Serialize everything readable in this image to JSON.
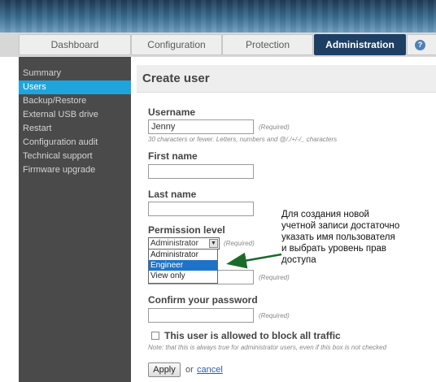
{
  "tabs": [
    {
      "label": "Dashboard"
    },
    {
      "label": "Configuration"
    },
    {
      "label": "Protection"
    },
    {
      "label": "Administration"
    }
  ],
  "sidebar": {
    "items": [
      {
        "label": "Summary"
      },
      {
        "label": "Users"
      },
      {
        "label": "Backup/Restore"
      },
      {
        "label": "External USB drive"
      },
      {
        "label": "Restart"
      },
      {
        "label": "Configuration audit"
      },
      {
        "label": "Technical support"
      },
      {
        "label": "Firmware upgrade"
      }
    ]
  },
  "page": {
    "title": "Create user"
  },
  "form": {
    "username_label": "Username",
    "username_value": "Jenny",
    "username_required": "(Required)",
    "username_hint": "30 characters or fewer. Letters, numbers and @/./+/-/_ characters",
    "firstname_label": "First name",
    "lastname_label": "Last name",
    "permission_label": "Permission level",
    "permission_selected": "Administrator",
    "permission_required": "(Required)",
    "permission_options": [
      "Administrator",
      "Engineer",
      "View only"
    ],
    "password_required": "(Required)",
    "confirm_label": "Confirm your password",
    "confirm_required": "(Required)",
    "block_label": "This user is allowed to block all traffic",
    "block_note": "Note: that this is always true for administrator users, even if this box is not checked",
    "apply_label": "Apply",
    "or_text": "or",
    "cancel_label": "cancel"
  },
  "annotation": {
    "text": "Для создания новой\nучетной записи достаточно\nуказать имя пользователя\nи выбрать уровень прав\nдоступа"
  },
  "colors": {
    "active_tab": "#1e3f63",
    "active_side": "#1fa5dc",
    "sidebar_bg": "#4a4a4a",
    "dropdown_highlight": "#1e73c8",
    "arrow": "#1a6b2a"
  }
}
